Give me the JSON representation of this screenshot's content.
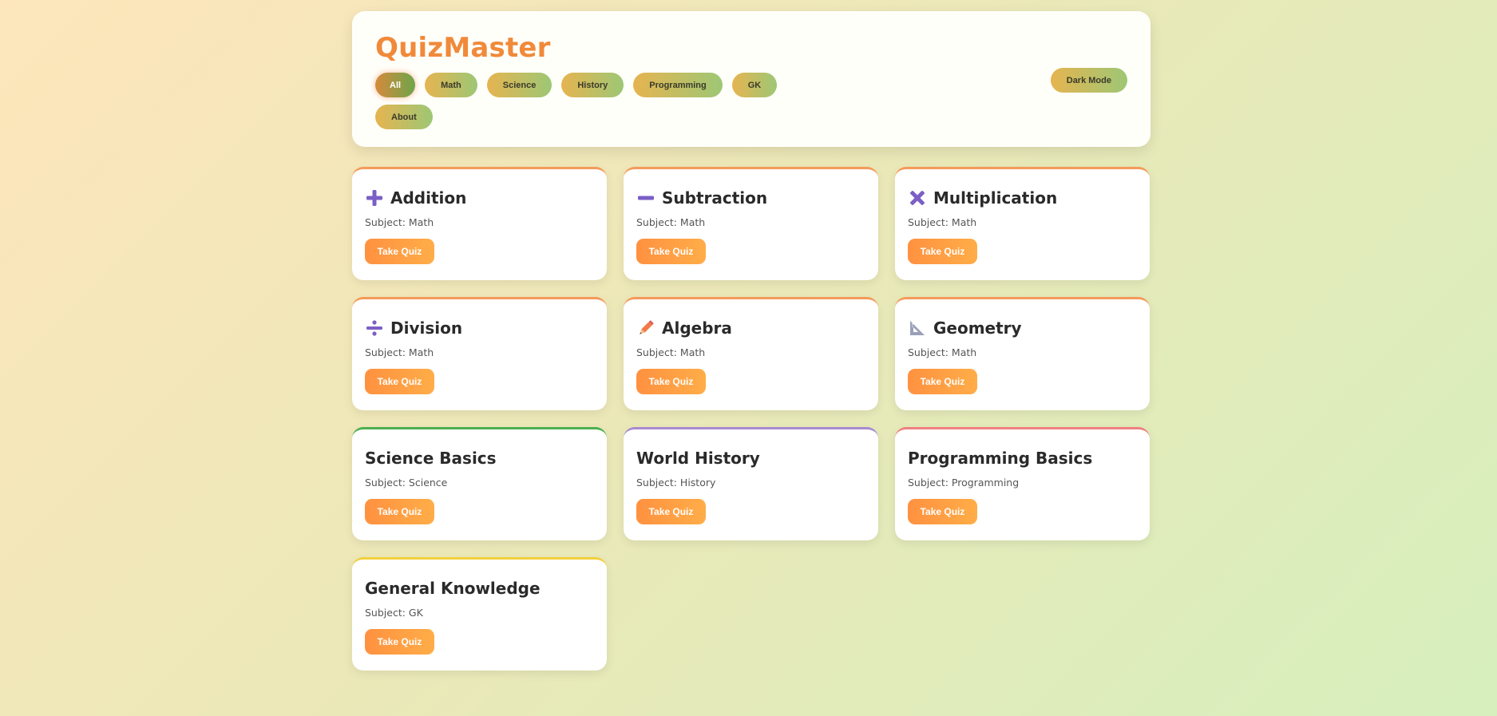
{
  "brand": "QuizMaster",
  "filters": [
    "All",
    "Math",
    "Science",
    "History",
    "Programming",
    "GK",
    "About"
  ],
  "active_filter": "All",
  "dark_mode_label": "Dark Mode",
  "cards": [
    {
      "title": "Addition",
      "subject": "Subject: Math",
      "button": "Take Quiz",
      "icon": "plus-icon",
      "accent": "#f49a5a"
    },
    {
      "title": "Subtraction",
      "subject": "Subject: Math",
      "button": "Take Quiz",
      "icon": "minus-icon",
      "accent": "#f49a5a"
    },
    {
      "title": "Multiplication",
      "subject": "Subject: Math",
      "button": "Take Quiz",
      "icon": "multiply-icon",
      "accent": "#f49a5a"
    },
    {
      "title": "Division",
      "subject": "Subject: Math",
      "button": "Take Quiz",
      "icon": "divide-icon",
      "accent": "#f49a5a"
    },
    {
      "title": "Algebra",
      "subject": "Subject: Math",
      "button": "Take Quiz",
      "icon": "pencil-icon",
      "accent": "#f49a5a"
    },
    {
      "title": "Geometry",
      "subject": "Subject: Math",
      "button": "Take Quiz",
      "icon": "triangle-ruler-icon",
      "accent": "#f49a5a"
    },
    {
      "title": "Science Basics",
      "subject": "Subject: Science",
      "button": "Take Quiz",
      "icon": "",
      "accent": "#4caf50"
    },
    {
      "title": "World History",
      "subject": "Subject: History",
      "button": "Take Quiz",
      "icon": "",
      "accent": "#a88ad0"
    },
    {
      "title": "Programming Basics",
      "subject": "Subject: Programming",
      "button": "Take Quiz",
      "icon": "",
      "accent": "#f08080"
    },
    {
      "title": "General Knowledge",
      "subject": "Subject: GK",
      "button": "Take Quiz",
      "icon": "",
      "accent": "#f2d03c"
    }
  ],
  "colors": {
    "brand": "#f08a3a",
    "button": "#ff9b45",
    "icon": "#7b5fc6"
  }
}
